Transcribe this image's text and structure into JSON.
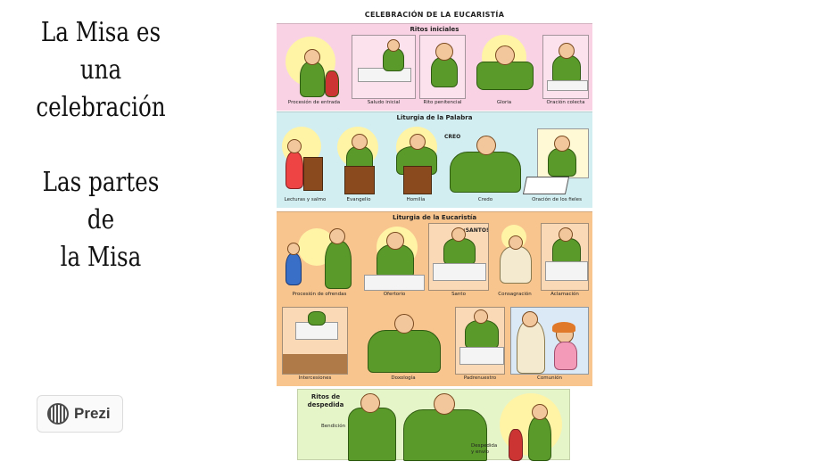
{
  "slide": {
    "title_line1": "La Misa es una",
    "title_line2": "celebración",
    "subtitle_line1": "Las partes de",
    "subtitle_line2": "la Misa"
  },
  "poster": {
    "title": "CELEBRACIÓN DE LA EUCARISTÍA",
    "sections": [
      {
        "name": "Ritos iniciales",
        "color": "#f9d3e3",
        "captions": [
          "Procesión de entrada",
          "Saludo inicial",
          "Rito penitencial",
          "Gloria",
          "Oración colecta"
        ]
      },
      {
        "name": "Liturgia de la Palabra",
        "color": "#d2eef0",
        "captions": [
          "Lecturas y salmo",
          "Evangelio",
          "Homilía",
          "Credo",
          "Oración de los fieles"
        ],
        "speech": "CREO"
      },
      {
        "name": "Liturgia de la Eucaristía",
        "color": "#f8c58f",
        "captions": [
          "Procesión de ofrendas",
          "Ofertorio",
          "Santo",
          "Consagración",
          "Aclamación"
        ],
        "speech": "¡SANTO!",
        "captions_row2": [
          "Intercesiones",
          "Doxología",
          "Padrenuestro",
          "Comunión"
        ]
      }
    ],
    "farewell": {
      "title": "Ritos de despedida",
      "color": "#e6f5c8",
      "labels": [
        "Bendición",
        "Despedida y envío"
      ]
    }
  },
  "branding": {
    "logo_text": "Prezi"
  }
}
